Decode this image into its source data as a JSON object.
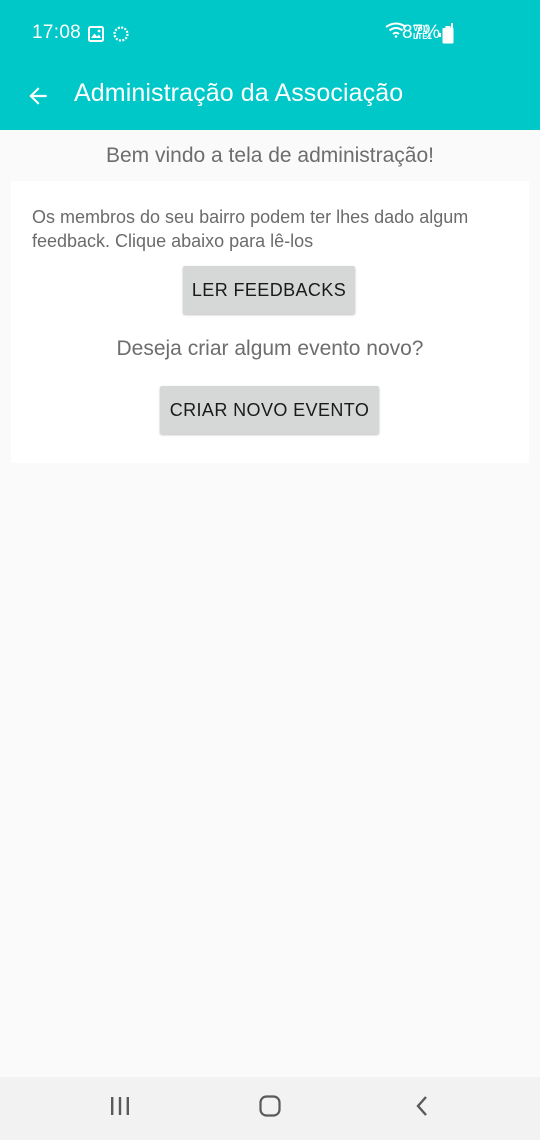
{
  "status_bar": {
    "time": "17:08",
    "battery": "87%",
    "left_icons": [
      "image-icon",
      "sync-icon"
    ],
    "right_icons": [
      "wifi-icon",
      "volte-icon",
      "signal-icon",
      "battery-icon"
    ],
    "volte_top": "Vo))",
    "volte_bottom": "LTE1"
  },
  "toolbar": {
    "title": "Administração da Associação",
    "back_icon": "arrow-back-icon",
    "background_color": "#00c8c8"
  },
  "main": {
    "welcome": "Bem vindo a tela de administração!",
    "feedback_text": "Os membros do seu bairro podem ter lhes dado algum feedback. Clique abaixo para lê-los",
    "feedback_button": "LER FEEDBACKS",
    "event_question": "Deseja criar algum evento novo?",
    "event_button": "CRIAR NOVO EVENTO"
  },
  "nav_bar": {
    "items": [
      "recent-apps-icon",
      "home-icon",
      "back-icon"
    ]
  }
}
